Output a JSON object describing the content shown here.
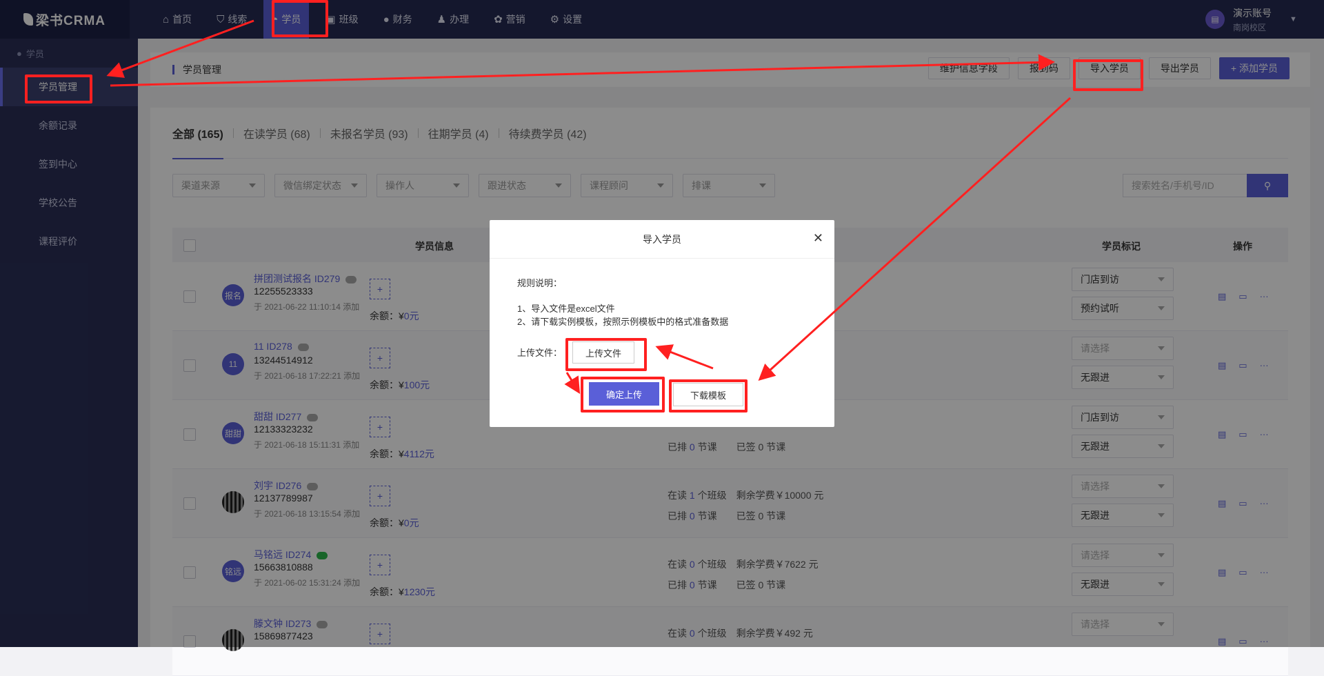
{
  "app": {
    "logo": "梁书CRMA"
  },
  "nav": [
    {
      "label": "首页",
      "icon": "home-icon"
    },
    {
      "label": "线索",
      "icon": "shield-icon"
    },
    {
      "label": "学员",
      "icon": "student-icon"
    },
    {
      "label": "班级",
      "icon": "class-icon"
    },
    {
      "label": "财务",
      "icon": "money-bag-icon"
    },
    {
      "label": "办理",
      "icon": "person-icon"
    },
    {
      "label": "营销",
      "icon": "marketing-icon"
    },
    {
      "label": "设置",
      "icon": "gear-icon"
    }
  ],
  "account": {
    "name": "演示账号",
    "campus": "南岗校区"
  },
  "sidebar": {
    "group": "学员",
    "items": [
      "学员管理",
      "余额记录",
      "签到中心",
      "学校公告",
      "课程评价"
    ]
  },
  "page": {
    "title": "学员管理"
  },
  "actions": {
    "maintain": "维护信息字段",
    "code": "报到码",
    "import": "导入学员",
    "export": "导出学员",
    "add": "+ 添加学员"
  },
  "tabs": [
    "全部 (165)",
    "在读学员 (68)",
    "未报名学员 (93)",
    "往期学员 (4)",
    "待续费学员 (42)"
  ],
  "filters": [
    "渠道来源",
    "微信绑定状态",
    "操作人",
    "跟进状态",
    "课程顾问",
    "排课"
  ],
  "search": {
    "placeholder": "搜索姓名/手机号/ID"
  },
  "table": {
    "headers": {
      "info": "学员信息",
      "tags": "学员标记",
      "ops": "操作"
    }
  },
  "rows": [
    {
      "avatar": "报名",
      "name": "拼团测试报名 ID279",
      "phone": "12255523333",
      "added": "于 2021-06-22 11:10:14 添加",
      "balance_label": "余额：¥",
      "balance": "0元",
      "cls1": [
        "",
        "",
        ""
      ],
      "cls2": [
        "",
        "",
        ""
      ],
      "tag1": "门店到访",
      "tag2": "预约试听"
    },
    {
      "avatar": "11",
      "name": "11 ID278",
      "phone": "13244514912",
      "added": "于 2021-06-18 17:22:21 添加",
      "balance_label": "余额：¥",
      "balance": "100元",
      "cls1": [
        "",
        "",
        ""
      ],
      "cls2": [
        "",
        "",
        ""
      ],
      "tag1": "请选择",
      "tag2": "无跟进"
    },
    {
      "avatar": "甜甜",
      "name": "甜甜 ID277",
      "phone": "12133323232",
      "added": "于 2021-06-18 15:11:31 添加",
      "balance_label": "余额：¥",
      "balance": "4112元",
      "cls1": [
        "",
        "",
        ""
      ],
      "cls2": [
        "已排",
        "0",
        "节课　　已签 0 节课"
      ],
      "tag1": "门店到访",
      "tag2": "无跟进"
    },
    {
      "avatar": "",
      "name": "刘宇 ID276",
      "phone": "12137789987",
      "added": "于 2021-06-18 13:15:54 添加",
      "balance_label": "余额：¥",
      "balance": "0元",
      "cls1": [
        "在读",
        "1",
        "个班级　剩余学费￥10000 元"
      ],
      "cls2": [
        "已排",
        "0",
        "节课　　已签 0 节课"
      ],
      "tag1": "请选择",
      "tag2": "无跟进"
    },
    {
      "avatar": "铭远",
      "name": "马铭远 ID274",
      "phone": "15663810888",
      "added": "于 2021-06-02 15:31:24 添加",
      "balance_label": "余额：¥",
      "balance": "1230元",
      "cls1": [
        "在读",
        "0",
        "个班级　剩余学费￥7622 元"
      ],
      "cls2": [
        "已排",
        "0",
        "节课　　已签 0 节课"
      ],
      "tag1": "请选择",
      "tag2": "无跟进"
    },
    {
      "avatar": "",
      "name": "滕文钟 ID273",
      "phone": "15869877423",
      "added": "",
      "balance_label": "",
      "balance": "",
      "cls1": [
        "在读",
        "0",
        "个班级　剩余学费￥492 元"
      ],
      "cls2": [
        "",
        "",
        ""
      ],
      "tag1": "请选择",
      "tag2": ""
    }
  ],
  "ops": [
    "note-icon",
    "screen-icon",
    "···"
  ],
  "modal": {
    "title": "导入学员",
    "rules_title": "规则说明：",
    "rule1": "1、导入文件是excel文件",
    "rule2": "2、请下载实例模板，按照示例模板中的格式准备数据",
    "upload_label": "上传文件：",
    "upload_button": "上传文件",
    "confirm": "确定上传",
    "download": "下载模板"
  }
}
